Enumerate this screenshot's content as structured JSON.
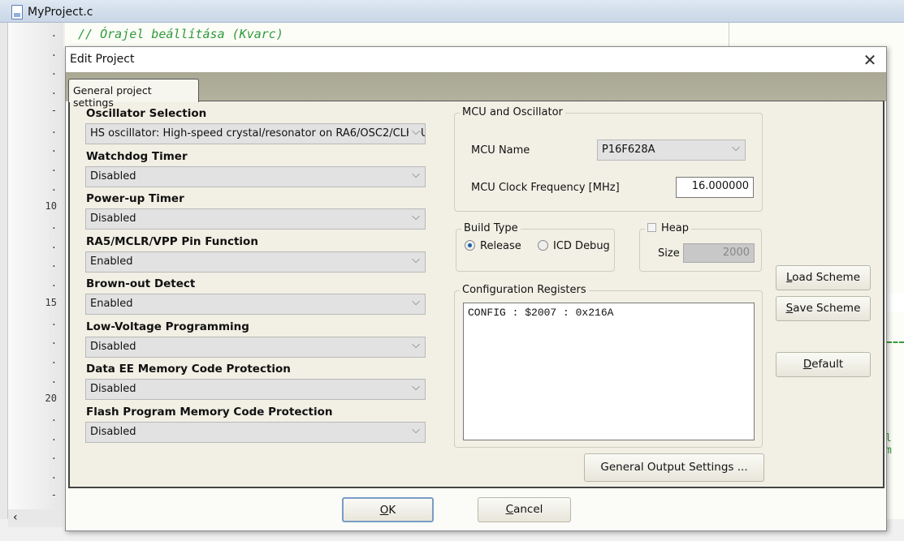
{
  "editor": {
    "file_tab": "MyProject.c",
    "code_line": "// Órajel beállítása (Kvarc)",
    "fragment": "l m",
    "gutter": [
      ".",
      ".",
      ".",
      ".",
      "-",
      ".",
      ".",
      ".",
      ".",
      "10",
      ".",
      ".",
      ".",
      ".",
      "15",
      ".",
      ".",
      ".",
      ".",
      "20",
      ".",
      ".",
      ".",
      ".",
      "-"
    ]
  },
  "dialog": {
    "title": "Edit Project",
    "tab": "General project settings",
    "fields": [
      {
        "label": "Oscillator Selection",
        "value": "HS oscillator: High-speed crystal/resonator on RA6/OSC2/CLKOU"
      },
      {
        "label": "Watchdog Timer",
        "value": "Disabled"
      },
      {
        "label": "Power-up Timer",
        "value": "Disabled"
      },
      {
        "label": "RA5/MCLR/VPP Pin Function",
        "value": "Enabled"
      },
      {
        "label": "Brown-out Detect",
        "value": "Enabled"
      },
      {
        "label": "Low-Voltage Programming",
        "value": "Disabled"
      },
      {
        "label": "Data EE Memory Code Protection",
        "value": "Disabled"
      },
      {
        "label": "Flash Program Memory Code Protection",
        "value": "Disabled"
      }
    ],
    "mcu": {
      "group": "MCU and Oscillator",
      "name_label": "MCU Name",
      "name_value": "P16F628A",
      "freq_label": "MCU Clock Frequency [MHz]",
      "freq_value": "16.000000"
    },
    "build": {
      "group": "Build Type",
      "release": "Release",
      "debug": "ICD Debug",
      "selected": "Release"
    },
    "heap": {
      "label": "Heap",
      "checked": false,
      "size_label": "Size",
      "size_value": "2000"
    },
    "config": {
      "group": "Configuration Registers",
      "text": "CONFIG : $2007 : 0x216A"
    },
    "buttons": {
      "general_output": "General Output Settings ...",
      "load_pre": "L",
      "load_rest": "oad Scheme",
      "save_pre": "S",
      "save_rest": "ave Scheme",
      "default_pre": "D",
      "default_rest": "efault",
      "ok_pre": "O",
      "ok_rest": "K",
      "cancel_pre": "C",
      "cancel_rest": "ancel"
    }
  }
}
